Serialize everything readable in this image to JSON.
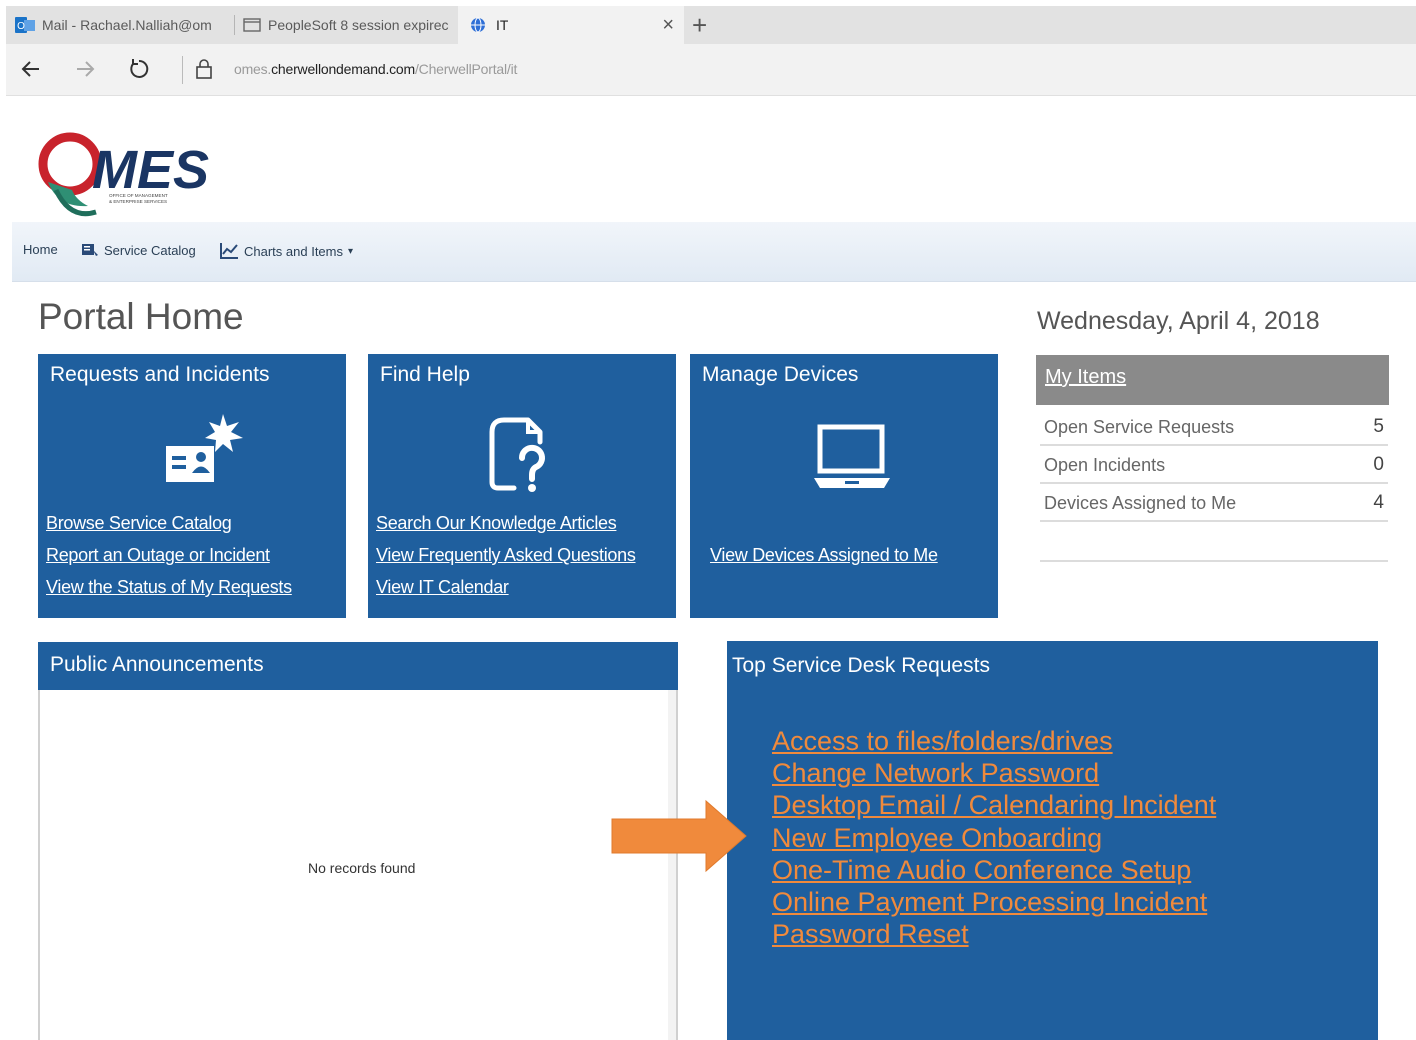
{
  "browser": {
    "tabs": [
      {
        "label": "Mail - Rachael.Nalliah@om",
        "icon": "outlook-icon",
        "active": false
      },
      {
        "label": "PeopleSoft 8 session expirec",
        "icon": "page-icon",
        "active": false
      },
      {
        "label": "IT",
        "icon": "globe-icon",
        "active": true
      }
    ],
    "close_tab": "×",
    "new_tab": "+",
    "url": {
      "prefix": "omes.",
      "domain": "cherwellondemand.com",
      "path": "/CherwellPortal/it"
    }
  },
  "logo": {
    "text": "MES",
    "subtext_line1": "OFFICE OF MANAGEMENT",
    "subtext_line2": "& ENTERPRISE SERVICES"
  },
  "nav": {
    "home": "Home",
    "service_catalog": "Service Catalog",
    "charts_and_items": "Charts and Items",
    "dropdown_caret": "▾"
  },
  "page_title": "Portal Home",
  "date": "Wednesday, April 4, 2018",
  "tiles": {
    "requests": {
      "title": "Requests and Incidents",
      "links": [
        "Browse Service Catalog",
        "Report an Outage or Incident",
        "View the Status of My Requests"
      ]
    },
    "help": {
      "title": "Find Help",
      "links": [
        "Search Our Knowledge Articles",
        "View Frequently Asked Questions",
        "View IT Calendar"
      ]
    },
    "devices": {
      "title": "Manage Devices",
      "links": [
        "View Devices Assigned to Me"
      ]
    }
  },
  "my_items": {
    "title": "My Items",
    "rows": [
      {
        "label": "Open Service Requests",
        "count": "5"
      },
      {
        "label": "Open Incidents",
        "count": "0"
      },
      {
        "label": "Devices Assigned to Me",
        "count": "4"
      }
    ]
  },
  "announcements": {
    "title": "Public Announcements",
    "empty_text": "No records found"
  },
  "top_requests": {
    "title": "Top Service Desk Requests",
    "links": [
      "Access to files/folders/drives",
      "Change Network Password",
      "Desktop Email / Calendaring Incident",
      "New Employee Onboarding",
      "One-Time Audio Conference Setup",
      "Online Payment Processing Incident",
      "Password Reset"
    ]
  },
  "colors": {
    "tile_blue": "#1f5f9e",
    "link_orange": "#f08a3c",
    "arrow_orange": "#f08a3c",
    "my_items_header": "#8a8a8a"
  }
}
